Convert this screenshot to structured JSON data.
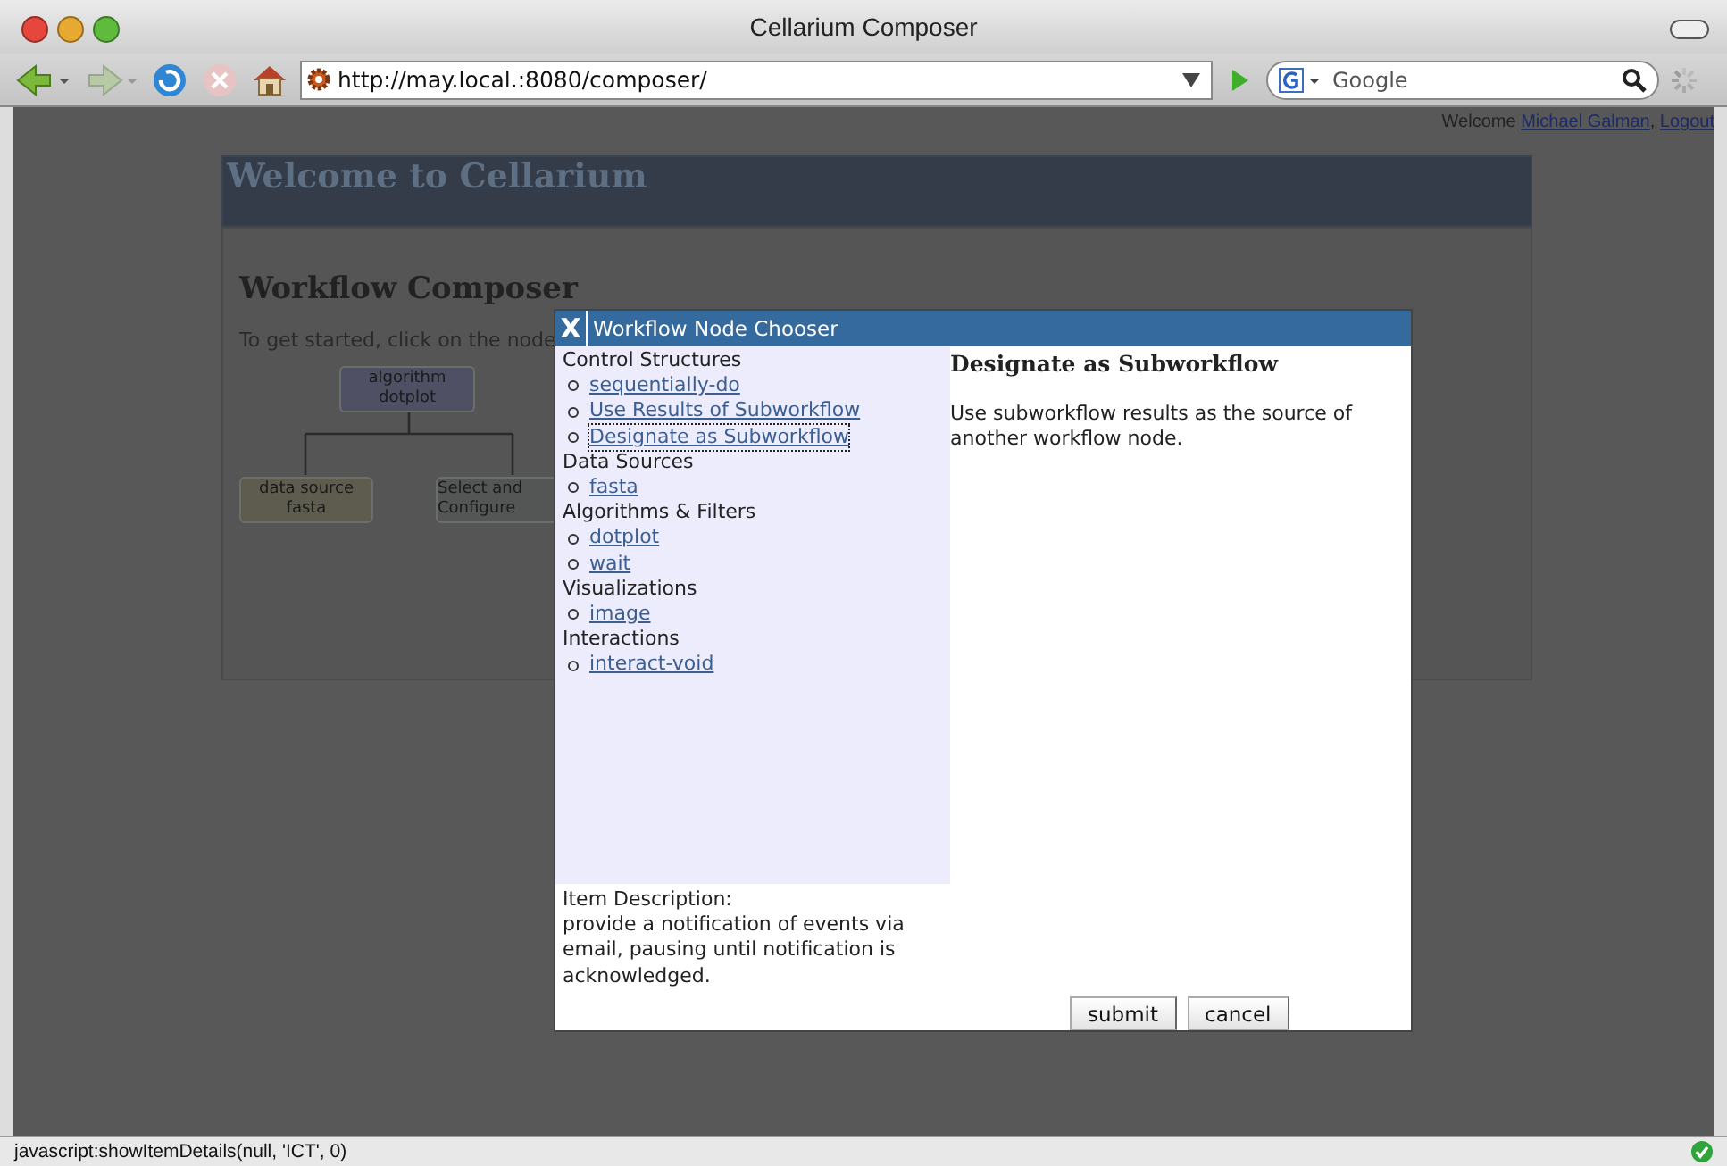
{
  "window": {
    "title": "Cellarium Composer"
  },
  "toolbar": {
    "url": "http://may.local.:8080/composer/",
    "search": {
      "placeholder": "Google"
    }
  },
  "page": {
    "welcome": "Welcome",
    "user_link": "Michael Galman",
    "separator": ",",
    "logout_link": "Logout",
    "header_title": "Welcome to Cellarium",
    "heading": "Workflow Composer",
    "intro": "To get started, click on the node",
    "diagram": [
      {
        "kind": "algorithm",
        "lines": [
          "algorithm",
          "dotplot"
        ]
      },
      {
        "kind": "source",
        "lines": [
          "data source",
          "fasta"
        ]
      },
      {
        "kind": "pending",
        "lines": [
          "Select and",
          "Configure"
        ]
      }
    ]
  },
  "dialog": {
    "close": "X",
    "title": "Workflow Node Chooser",
    "categories": [
      {
        "label": "Control Structures",
        "items": [
          {
            "label": "sequentially-do",
            "selected": false
          },
          {
            "label": "Use Results of Subworkflow",
            "selected": false
          },
          {
            "label": "Designate as Subworkflow",
            "selected": true
          }
        ]
      },
      {
        "label": "Data Sources",
        "items": [
          {
            "label": "fasta",
            "selected": false
          }
        ]
      },
      {
        "label": "Algorithms & Filters",
        "items": [
          {
            "label": "dotplot",
            "selected": false
          },
          {
            "label": "wait",
            "selected": false
          }
        ]
      },
      {
        "label": "Visualizations",
        "items": [
          {
            "label": "image",
            "selected": false
          }
        ]
      },
      {
        "label": "Interactions",
        "items": [
          {
            "label": "interact-void",
            "selected": false
          }
        ]
      }
    ],
    "detail_title": "Designate as Subworkflow",
    "detail_text": "Use subworkflow results as the source of another workflow node.",
    "description_label": "Item Description:",
    "description_text": "provide a notification of events via email, pausing until notification is acknowledged.",
    "buttons": [
      "submit",
      "cancel"
    ]
  },
  "status_bar": {
    "text": "javascript:showItemDetails(null, 'ICT', 0)"
  }
}
